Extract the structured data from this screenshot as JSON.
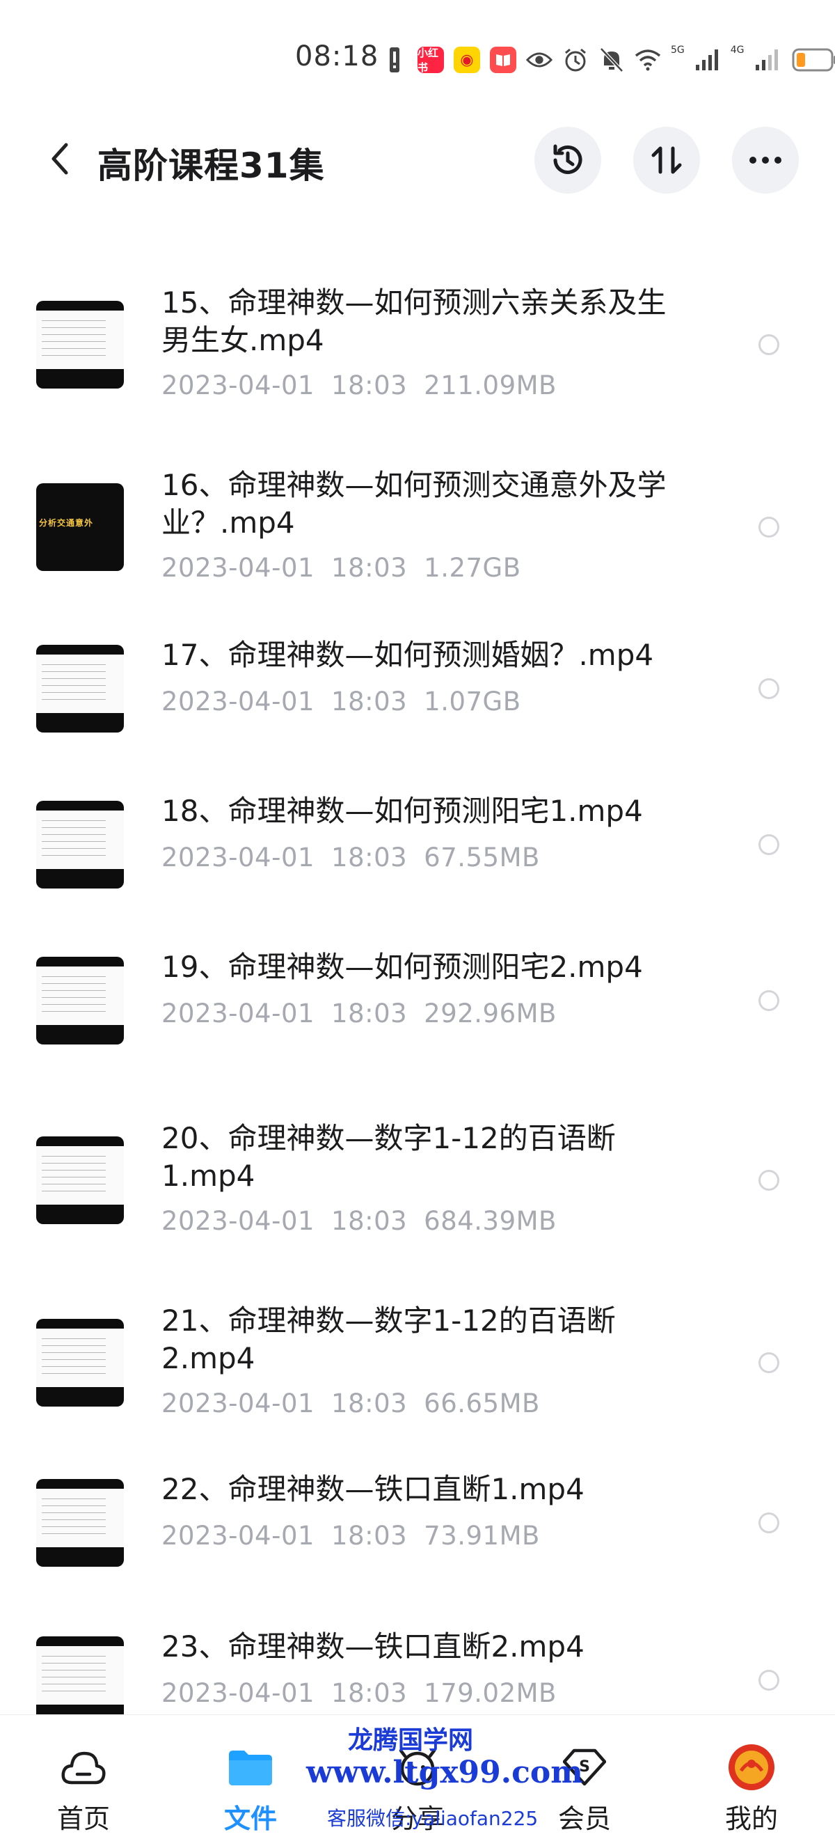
{
  "status_bar": {
    "time": "08:18",
    "app_icon_1": "小红书",
    "net_label_1": "5G",
    "net_label_2": "4G"
  },
  "header": {
    "title": "高阶课程31集",
    "history_icon": "history-icon",
    "sort_icon": "sort-icon",
    "more_icon": "more-icon"
  },
  "files": [
    {
      "name": "15、命理神数—如何预测六亲关系及生男生女.mp4",
      "date": "2023-04-01",
      "time": "18:03",
      "size": "211.09MB"
    },
    {
      "name": "16、命理神数—如何预测交通意外及学业？.mp4",
      "date": "2023-04-01",
      "time": "18:03",
      "size": "1.27GB"
    },
    {
      "name": "17、命理神数—如何预测婚姻？.mp4",
      "date": "2023-04-01",
      "time": "18:03",
      "size": "1.07GB"
    },
    {
      "name": "18、命理神数—如何预测阳宅1.mp4",
      "date": "2023-04-01",
      "time": "18:03",
      "size": "67.55MB"
    },
    {
      "name": "19、命理神数—如何预测阳宅2.mp4",
      "date": "2023-04-01",
      "time": "18:03",
      "size": "292.96MB"
    },
    {
      "name": "20、命理神数—数字1-12的百语断1.mp4",
      "date": "2023-04-01",
      "time": "18:03",
      "size": "684.39MB"
    },
    {
      "name": "21、命理神数—数字1-12的百语断2.mp4",
      "date": "2023-04-01",
      "time": "18:03",
      "size": "66.65MB"
    },
    {
      "name": "22、命理神数—铁口直断1.mp4",
      "date": "2023-04-01",
      "time": "18:03",
      "size": "73.91MB"
    },
    {
      "name": "23、命理神数—铁口直断2.mp4",
      "date": "2023-04-01",
      "time": "18:03",
      "size": "179.02MB"
    }
  ],
  "bottom_nav": [
    {
      "label": "首页",
      "icon": "home-cloud-icon"
    },
    {
      "label": "文件",
      "icon": "folder-icon",
      "active": true
    },
    {
      "label": "分享",
      "icon": "share-icon"
    },
    {
      "label": "会员",
      "icon": "vip-icon"
    },
    {
      "label": "我的",
      "icon": "avatar-icon"
    }
  ],
  "watermark": {
    "line1": "龙腾国学网",
    "url": "www.ltgx99.com",
    "line3": "客服微信:yaliaofan225"
  },
  "colors": {
    "accent": "#1e90ff",
    "meta_gray": "#a7a9b0",
    "button_bg": "#f0f1f4"
  }
}
